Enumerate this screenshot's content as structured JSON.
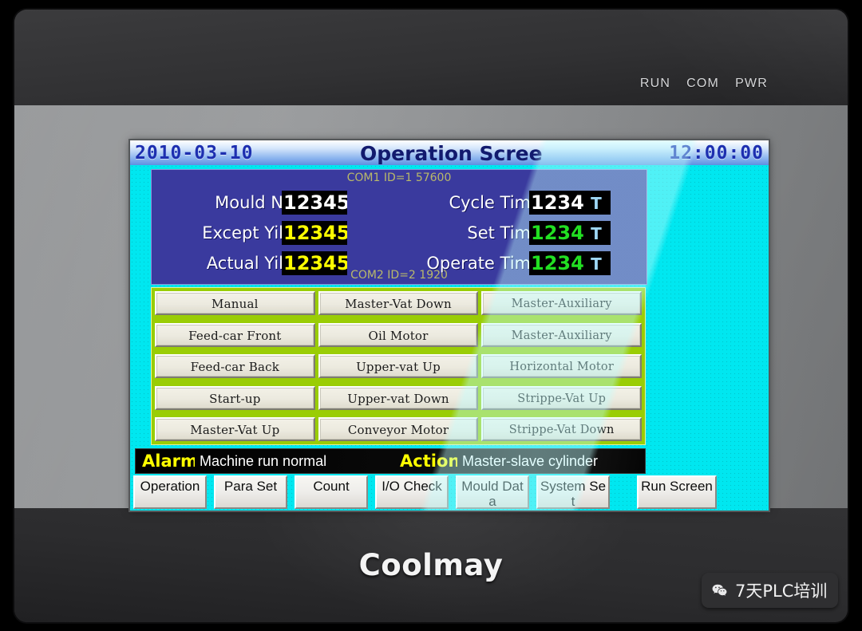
{
  "device": {
    "brand": "Coolmay",
    "leds": [
      {
        "label": "RUN"
      },
      {
        "label": "COM"
      },
      {
        "label": "PWR"
      }
    ]
  },
  "screen": {
    "title_bar": {
      "date": "2010-03-10",
      "time": "12:00:00",
      "title": "Operation Scree"
    },
    "info_panel": {
      "com1": "COM1 ID=1 57600",
      "com2": "COM2 ID=2 1920",
      "left_fields": [
        {
          "label": "Mould N",
          "value": "12345",
          "unit": "",
          "color": "white"
        },
        {
          "label": "Except Yil",
          "value": "12345",
          "unit": "",
          "color": "yellow"
        },
        {
          "label": "Actual Yil",
          "value": "12345",
          "unit": "",
          "color": "yellow"
        }
      ],
      "right_fields": [
        {
          "label": "Cycle Tim",
          "value": "1234",
          "unit": "T",
          "color": "white"
        },
        {
          "label": "Set Tim",
          "value": "1234",
          "unit": "T",
          "color": "green"
        },
        {
          "label": "Operate Tim",
          "value": "1234",
          "unit": "T",
          "color": "green"
        }
      ]
    },
    "button_panel": {
      "columns": [
        {
          "buttons": [
            {
              "label": "Manual"
            },
            {
              "label": "Feed-car Front"
            },
            {
              "label": "Feed-car Back"
            },
            {
              "label": "Start-up"
            },
            {
              "label": "Master-Vat Up"
            }
          ]
        },
        {
          "buttons": [
            {
              "label": "Master-Vat Down"
            },
            {
              "label": "Oil Motor"
            },
            {
              "label": "Upper-vat Up"
            },
            {
              "label": "Upper-vat Down"
            },
            {
              "label": "Conveyor Motor"
            }
          ]
        },
        {
          "buttons": [
            {
              "label": "Master-Auxiliary"
            },
            {
              "label": "Master-Auxiliary"
            },
            {
              "label": "Horizontal Motor"
            },
            {
              "label": "Strippe-Vat Up"
            },
            {
              "label": "Strippe-Vat Down"
            }
          ]
        }
      ]
    },
    "alarm_bar": {
      "alarm_key": "Alarm",
      "alarm_message": "Machine run normal",
      "action_key": "Action",
      "action_message": "Master-slave cylinder"
    },
    "nav_bar": {
      "buttons": [
        {
          "label": "Operation"
        },
        {
          "label": "Para Set"
        },
        {
          "label": "Count"
        },
        {
          "label": "I/O Check"
        },
        {
          "label": "Mould Data"
        },
        {
          "label": "System Set"
        },
        {
          "label": "Run Screen"
        }
      ]
    }
  },
  "watermark": {
    "text": "7天PLC培训",
    "icon": "wechat-icon"
  },
  "colors": {
    "screen_background": "#00e7f0",
    "info_panel": "#3a3a9e",
    "button_panel": "#9acd05",
    "button_face": "#eceadf",
    "alarm_key": "#ffff00",
    "value_yellow": "#ffff00",
    "value_green": "#22e022",
    "value_white": "#ffffff",
    "lcd_digit": "#1d2fb0"
  }
}
